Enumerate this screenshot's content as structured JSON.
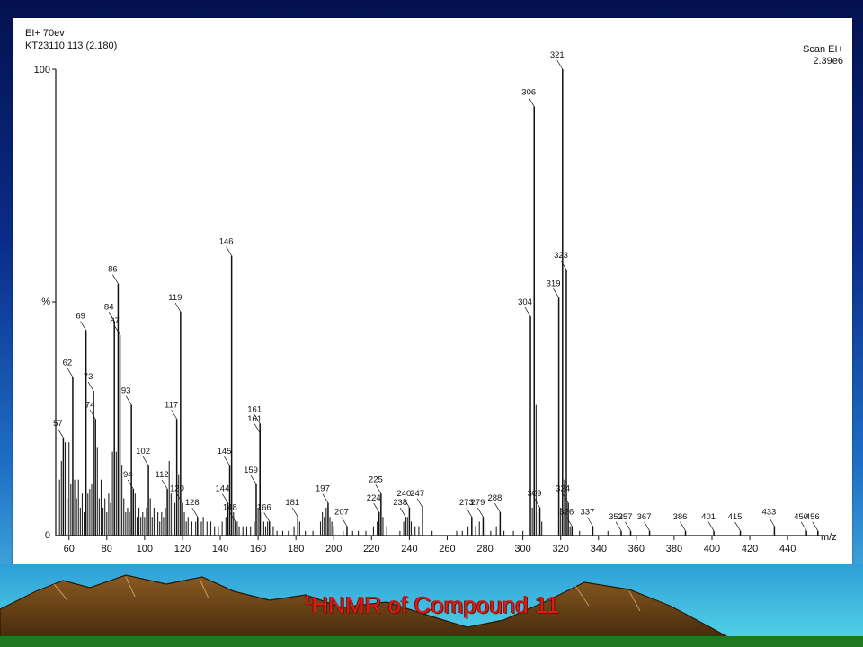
{
  "header": {
    "line1": "EI+ 70ev",
    "line2": "KT23110 113 (2.180)",
    "scan": "Scan EI+",
    "intensity": "2.39e6"
  },
  "y_axis": {
    "top_label": "100",
    "mid_label": "%",
    "zero_label": "0"
  },
  "x_axis": {
    "unit_label": "m/z"
  },
  "caption": {
    "sup": "1",
    "text": "HNMR of Compound  11"
  },
  "colors": {
    "caption": "#e8141b",
    "ink": "#111111",
    "background_top": "#04114e",
    "background_bottom": "#56c9e6"
  },
  "chart_data": {
    "type": "bar",
    "title": "",
    "xlabel": "m/z",
    "ylabel": "%",
    "xlim": [
      53,
      458
    ],
    "ylim": [
      0,
      100
    ],
    "x_ticks": [
      60,
      80,
      100,
      120,
      140,
      160,
      180,
      200,
      220,
      240,
      260,
      280,
      300,
      320,
      340,
      360,
      380,
      400,
      420,
      440
    ],
    "labeled_peaks": [
      {
        "mz": 57,
        "label": "57",
        "value": 21
      },
      {
        "mz": 62,
        "label": "62",
        "value": 34
      },
      {
        "mz": 69,
        "label": "69",
        "value": 44
      },
      {
        "mz": 73,
        "label": "73",
        "value": 31
      },
      {
        "mz": 74,
        "label": "74",
        "value": 25
      },
      {
        "mz": 84,
        "label": "84",
        "value": 46
      },
      {
        "mz": 86,
        "label": "86",
        "value": 54
      },
      {
        "mz": 87,
        "label": "87",
        "value": 43
      },
      {
        "mz": 93,
        "label": "93",
        "value": 28
      },
      {
        "mz": 94,
        "label": "94",
        "value": 10
      },
      {
        "mz": 102,
        "label": "102",
        "value": 15
      },
      {
        "mz": 112,
        "label": "112",
        "value": 10
      },
      {
        "mz": 117,
        "label": "117",
        "value": 25
      },
      {
        "mz": 119,
        "label": "119",
        "value": 48
      },
      {
        "mz": 120,
        "label": "120",
        "value": 7
      },
      {
        "mz": 128,
        "label": "128",
        "value": 4
      },
      {
        "mz": 144,
        "label": "144",
        "value": 7
      },
      {
        "mz": 145,
        "label": "145",
        "value": 15
      },
      {
        "mz": 146,
        "label": "146",
        "value": 60
      },
      {
        "mz": 148,
        "label": "148",
        "value": 3
      },
      {
        "mz": 159,
        "label": "159",
        "value": 11
      },
      {
        "mz": 161,
        "label": "161",
        "value": 24
      },
      {
        "mz": 161,
        "label": "161",
        "value": 22
      },
      {
        "mz": 166,
        "label": "166",
        "value": 3
      },
      {
        "mz": 181,
        "label": "181",
        "value": 4
      },
      {
        "mz": 197,
        "label": "197",
        "value": 7
      },
      {
        "mz": 207,
        "label": "207",
        "value": 2
      },
      {
        "mz": 224,
        "label": "224",
        "value": 5
      },
      {
        "mz": 225,
        "label": "225",
        "value": 9
      },
      {
        "mz": 238,
        "label": "238",
        "value": 4
      },
      {
        "mz": 240,
        "label": "240",
        "value": 6
      },
      {
        "mz": 247,
        "label": "247",
        "value": 6
      },
      {
        "mz": 273,
        "label": "273",
        "value": 4
      },
      {
        "mz": 279,
        "label": "279",
        "value": 4
      },
      {
        "mz": 288,
        "label": "288",
        "value": 5
      },
      {
        "mz": 304,
        "label": "304",
        "value": 47
      },
      {
        "mz": 306,
        "label": "306",
        "value": 92
      },
      {
        "mz": 309,
        "label": "309",
        "value": 6
      },
      {
        "mz": 319,
        "label": "319",
        "value": 51
      },
      {
        "mz": 321,
        "label": "321",
        "value": 100
      },
      {
        "mz": 323,
        "label": "323",
        "value": 57
      },
      {
        "mz": 324,
        "label": "324",
        "value": 7
      },
      {
        "mz": 326,
        "label": "326",
        "value": 2
      },
      {
        "mz": 337,
        "label": "337",
        "value": 2
      },
      {
        "mz": 352,
        "label": "352",
        "value": 1
      },
      {
        "mz": 357,
        "label": "357",
        "value": 1
      },
      {
        "mz": 367,
        "label": "367",
        "value": 1
      },
      {
        "mz": 386,
        "label": "386",
        "value": 1
      },
      {
        "mz": 401,
        "label": "401",
        "value": 1
      },
      {
        "mz": 415,
        "label": "415",
        "value": 1
      },
      {
        "mz": 433,
        "label": "433",
        "value": 2
      },
      {
        "mz": 450,
        "label": "450",
        "value": 1
      },
      {
        "mz": 456,
        "label": "456",
        "value": 1
      }
    ],
    "minor_peaks": [
      {
        "mz": 55,
        "value": 12
      },
      {
        "mz": 56,
        "value": 16
      },
      {
        "mz": 58,
        "value": 20
      },
      {
        "mz": 59,
        "value": 8
      },
      {
        "mz": 60,
        "value": 20
      },
      {
        "mz": 61,
        "value": 11
      },
      {
        "mz": 63,
        "value": 12
      },
      {
        "mz": 64,
        "value": 8
      },
      {
        "mz": 65,
        "value": 12
      },
      {
        "mz": 66,
        "value": 6
      },
      {
        "mz": 67,
        "value": 9
      },
      {
        "mz": 68,
        "value": 5
      },
      {
        "mz": 70,
        "value": 9
      },
      {
        "mz": 71,
        "value": 10
      },
      {
        "mz": 72,
        "value": 11
      },
      {
        "mz": 75,
        "value": 19
      },
      {
        "mz": 76,
        "value": 8
      },
      {
        "mz": 77,
        "value": 12
      },
      {
        "mz": 78,
        "value": 6
      },
      {
        "mz": 79,
        "value": 8
      },
      {
        "mz": 80,
        "value": 5
      },
      {
        "mz": 81,
        "value": 9
      },
      {
        "mz": 82,
        "value": 7
      },
      {
        "mz": 83,
        "value": 18
      },
      {
        "mz": 85,
        "value": 18
      },
      {
        "mz": 88,
        "value": 15
      },
      {
        "mz": 89,
        "value": 8
      },
      {
        "mz": 90,
        "value": 5
      },
      {
        "mz": 91,
        "value": 6
      },
      {
        "mz": 92,
        "value": 5
      },
      {
        "mz": 95,
        "value": 9
      },
      {
        "mz": 96,
        "value": 4
      },
      {
        "mz": 97,
        "value": 6
      },
      {
        "mz": 98,
        "value": 4
      },
      {
        "mz": 99,
        "value": 5
      },
      {
        "mz": 100,
        "value": 4
      },
      {
        "mz": 101,
        "value": 6
      },
      {
        "mz": 103,
        "value": 8
      },
      {
        "mz": 104,
        "value": 4
      },
      {
        "mz": 105,
        "value": 6
      },
      {
        "mz": 106,
        "value": 4
      },
      {
        "mz": 107,
        "value": 5
      },
      {
        "mz": 108,
        "value": 3
      },
      {
        "mz": 109,
        "value": 5
      },
      {
        "mz": 110,
        "value": 4
      },
      {
        "mz": 111,
        "value": 6
      },
      {
        "mz": 113,
        "value": 16
      },
      {
        "mz": 114,
        "value": 9
      },
      {
        "mz": 115,
        "value": 14
      },
      {
        "mz": 116,
        "value": 7
      },
      {
        "mz": 118,
        "value": 13
      },
      {
        "mz": 121,
        "value": 5
      },
      {
        "mz": 122,
        "value": 3
      },
      {
        "mz": 123,
        "value": 4
      },
      {
        "mz": 125,
        "value": 3
      },
      {
        "mz": 127,
        "value": 3
      },
      {
        "mz": 130,
        "value": 3
      },
      {
        "mz": 131,
        "value": 4
      },
      {
        "mz": 133,
        "value": 3
      },
      {
        "mz": 135,
        "value": 3
      },
      {
        "mz": 137,
        "value": 2
      },
      {
        "mz": 139,
        "value": 2
      },
      {
        "mz": 141,
        "value": 3
      },
      {
        "mz": 143,
        "value": 4
      },
      {
        "mz": 147,
        "value": 5
      },
      {
        "mz": 149,
        "value": 3
      },
      {
        "mz": 150,
        "value": 2
      },
      {
        "mz": 152,
        "value": 2
      },
      {
        "mz": 154,
        "value": 2
      },
      {
        "mz": 156,
        "value": 2
      },
      {
        "mz": 158,
        "value": 3
      },
      {
        "mz": 160,
        "value": 6
      },
      {
        "mz": 162,
        "value": 5
      },
      {
        "mz": 163,
        "value": 3
      },
      {
        "mz": 164,
        "value": 2
      },
      {
        "mz": 165,
        "value": 3
      },
      {
        "mz": 168,
        "value": 2
      },
      {
        "mz": 170,
        "value": 1
      },
      {
        "mz": 173,
        "value": 1
      },
      {
        "mz": 176,
        "value": 1
      },
      {
        "mz": 179,
        "value": 2
      },
      {
        "mz": 182,
        "value": 3
      },
      {
        "mz": 185,
        "value": 1
      },
      {
        "mz": 189,
        "value": 1
      },
      {
        "mz": 193,
        "value": 3
      },
      {
        "mz": 194,
        "value": 5
      },
      {
        "mz": 195,
        "value": 4
      },
      {
        "mz": 196,
        "value": 6
      },
      {
        "mz": 198,
        "value": 4
      },
      {
        "mz": 199,
        "value": 3
      },
      {
        "mz": 200,
        "value": 2
      },
      {
        "mz": 205,
        "value": 1
      },
      {
        "mz": 210,
        "value": 1
      },
      {
        "mz": 213,
        "value": 1
      },
      {
        "mz": 217,
        "value": 1
      },
      {
        "mz": 221,
        "value": 2
      },
      {
        "mz": 223,
        "value": 3
      },
      {
        "mz": 226,
        "value": 4
      },
      {
        "mz": 228,
        "value": 2
      },
      {
        "mz": 235,
        "value": 1
      },
      {
        "mz": 237,
        "value": 3
      },
      {
        "mz": 239,
        "value": 4
      },
      {
        "mz": 241,
        "value": 3
      },
      {
        "mz": 243,
        "value": 2
      },
      {
        "mz": 245,
        "value": 2
      },
      {
        "mz": 252,
        "value": 1
      },
      {
        "mz": 265,
        "value": 1
      },
      {
        "mz": 268,
        "value": 1
      },
      {
        "mz": 271,
        "value": 2
      },
      {
        "mz": 275,
        "value": 2
      },
      {
        "mz": 277,
        "value": 3
      },
      {
        "mz": 280,
        "value": 2
      },
      {
        "mz": 283,
        "value": 1
      },
      {
        "mz": 286,
        "value": 2
      },
      {
        "mz": 290,
        "value": 1
      },
      {
        "mz": 295,
        "value": 1
      },
      {
        "mz": 300,
        "value": 1
      },
      {
        "mz": 305,
        "value": 6
      },
      {
        "mz": 307,
        "value": 28
      },
      {
        "mz": 308,
        "value": 5
      },
      {
        "mz": 310,
        "value": 3
      },
      {
        "mz": 320,
        "value": 6
      },
      {
        "mz": 322,
        "value": 12
      },
      {
        "mz": 325,
        "value": 2
      },
      {
        "mz": 330,
        "value": 1
      },
      {
        "mz": 345,
        "value": 1
      }
    ]
  }
}
